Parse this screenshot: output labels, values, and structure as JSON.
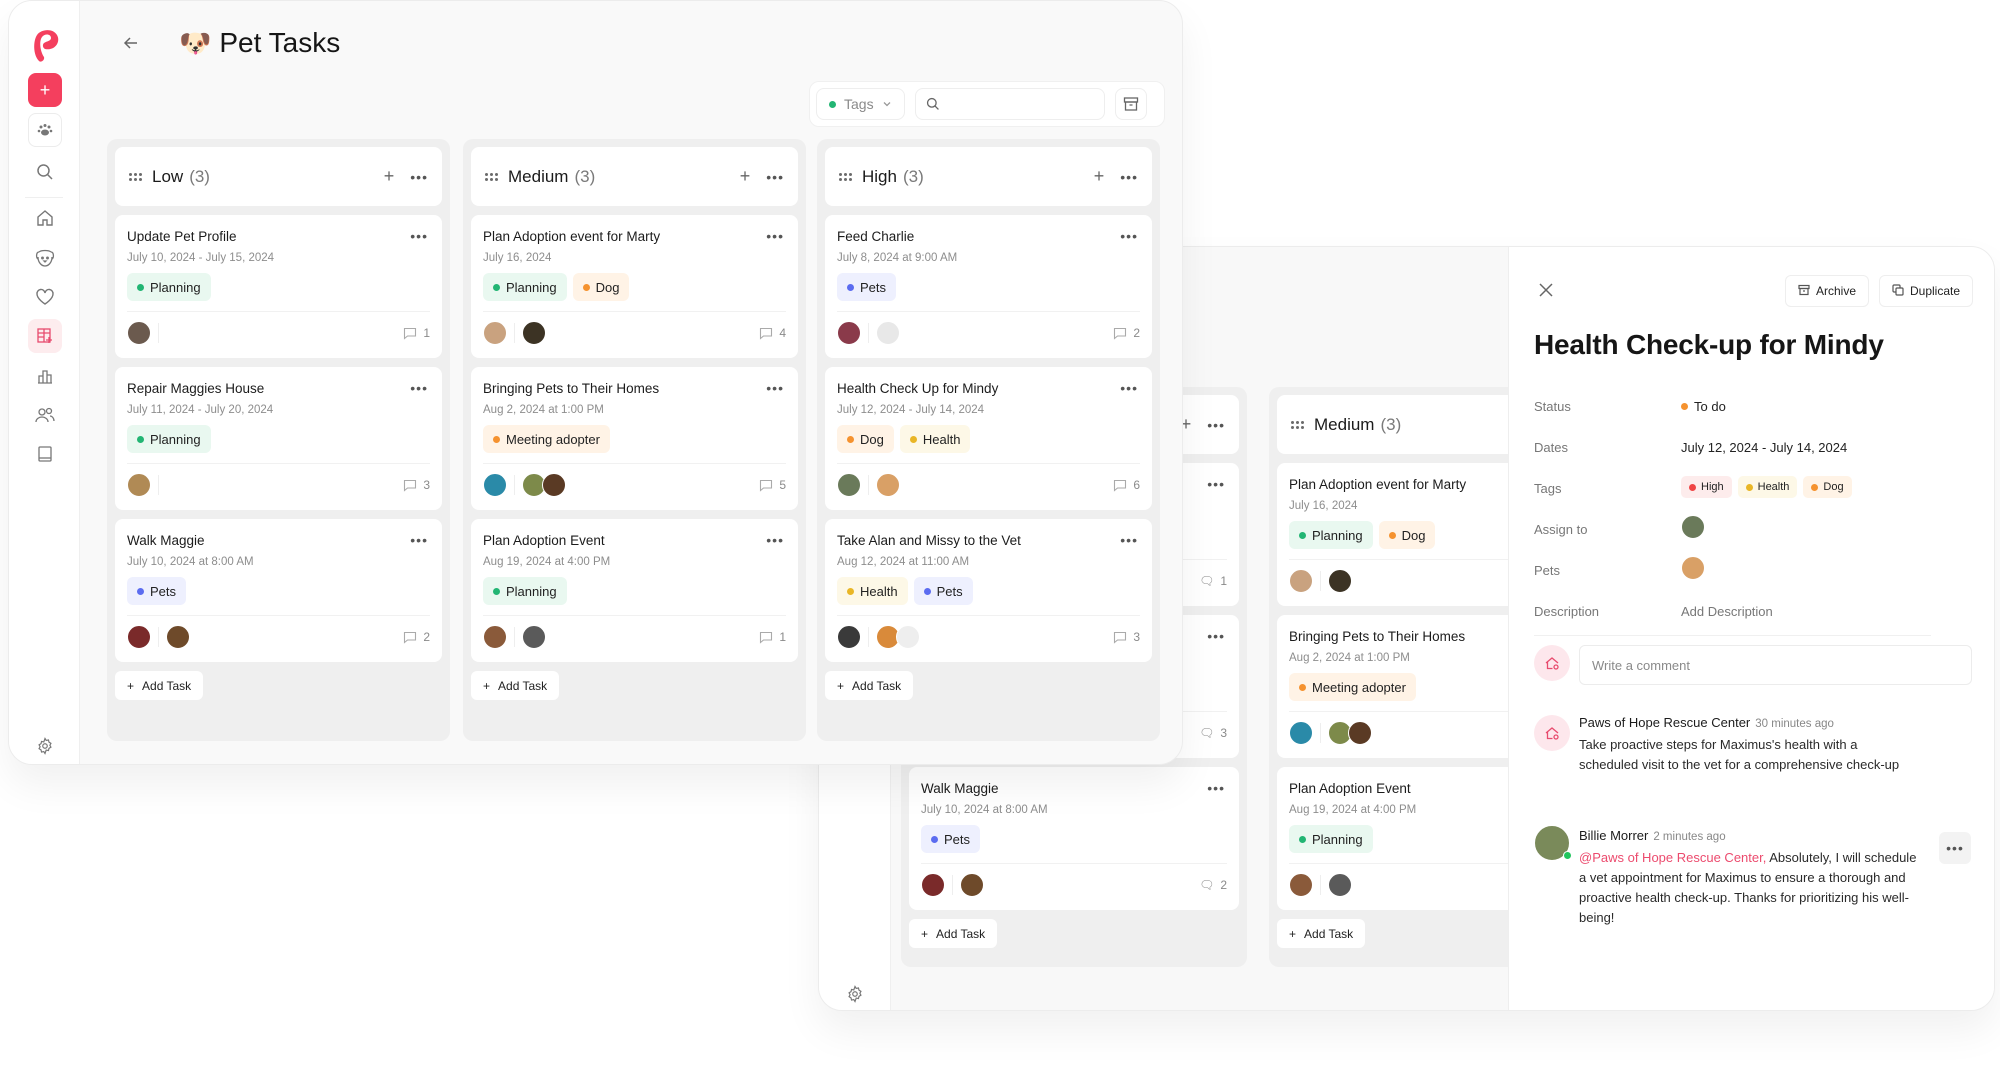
{
  "app": {
    "page_title": "Pet Tasks",
    "title_emoji": "🐶",
    "sidebar_items": [
      "add",
      "community",
      "search",
      "home",
      "pets",
      "favorites",
      "task-board",
      "reports",
      "people",
      "guides",
      "settings"
    ]
  },
  "toolbar": {
    "tags_label": "Tags",
    "search_placeholder": "",
    "archive_icon": "archive-icon"
  },
  "colors": {
    "accent": "#f43f5e",
    "planning": "#22b573",
    "dog": "#f5922f",
    "pets": "#5b6cf0",
    "health": "#e9b626",
    "high": "#ef4444",
    "meeting": "#f5922f"
  },
  "tag_styles": {
    "Planning": {
      "dot": "#22b573",
      "bg": "#e9f8f0"
    },
    "Dog": {
      "dot": "#f5922f",
      "bg": "#fff3e6"
    },
    "Pets": {
      "dot": "#5b6cf0",
      "bg": "#eef0fe"
    },
    "Health": {
      "dot": "#e9b626",
      "bg": "#fdf8e7"
    },
    "Meeting adopter": {
      "dot": "#f5922f",
      "bg": "#fff3e6"
    },
    "High": {
      "dot": "#ef4444",
      "bg": "#fdecec"
    }
  },
  "columns": [
    {
      "title": "Low",
      "count": "(3)",
      "cards": [
        {
          "title": "Update Pet Profile",
          "date": "July 10, 2024 - July 15, 2024",
          "tags": [
            "Planning"
          ],
          "assignees": [
            "#6b5a4e"
          ],
          "pets": [],
          "comments": "1"
        },
        {
          "title": "Repair Maggies House",
          "date": "July 11, 2024 - July 20, 2024",
          "tags": [
            "Planning"
          ],
          "assignees": [
            "#b08a55"
          ],
          "pets": [],
          "comments": "3"
        },
        {
          "title": "Walk Maggie",
          "date": "July 10, 2024 at 8:00 AM",
          "tags": [
            "Pets"
          ],
          "assignees": [
            "#7a2a2a"
          ],
          "pets": [
            "#6e4a2a"
          ],
          "comments": "2"
        }
      ],
      "add_label": "Add Task"
    },
    {
      "title": "Medium",
      "count": "(3)",
      "cards": [
        {
          "title": "Plan Adoption event for Marty",
          "date": "July 16, 2024",
          "tags": [
            "Planning",
            "Dog"
          ],
          "assignees": [
            "#c9a27f"
          ],
          "pets": [
            "#3c3324"
          ],
          "comments": "4"
        },
        {
          "title": "Bringing Pets to Their Homes",
          "date": "Aug 2, 2024 at 1:00 PM",
          "tags": [
            "Meeting adopter"
          ],
          "assignees": [
            "#2a8aa8"
          ],
          "pets": [
            "#7d8a4a",
            "#5a3a24"
          ],
          "comments": "5"
        },
        {
          "title": "Plan Adoption Event",
          "date": "Aug 19, 2024 at 4:00 PM",
          "tags": [
            "Planning"
          ],
          "assignees": [
            "#8a5a3a"
          ],
          "pets": [
            "#5a5a5a"
          ],
          "comments": "1"
        }
      ],
      "add_label": "Add Task"
    },
    {
      "title": "High",
      "count": "(3)",
      "cards": [
        {
          "title": "Feed Charlie",
          "date": "July 8, 2024 at 9:00 AM",
          "tags": [
            "Pets"
          ],
          "assignees": [
            "#8a3a4a"
          ],
          "pets": [
            "#e8e8e8"
          ],
          "comments": "2"
        },
        {
          "title": "Health Check Up for Mindy",
          "date": "July 12, 2024 - July 14, 2024",
          "tags": [
            "Dog",
            "Health"
          ],
          "assignees": [
            "#6a7a5a"
          ],
          "pets": [
            "#d9a066"
          ],
          "comments": "6"
        },
        {
          "title": "Take Alan and Missy to the Vet",
          "date": "Aug 12, 2024 at 11:00 AM",
          "tags": [
            "Health",
            "Pets"
          ],
          "assignees": [
            "#3a3a3a"
          ],
          "pets": [
            "#d98a3a",
            "#eeeeee"
          ],
          "comments": "3"
        }
      ],
      "add_label": "Add Task"
    }
  ],
  "detail": {
    "close_icon": "close-icon",
    "archive_label": "Archive",
    "duplicate_label": "Duplicate",
    "title": "Health Check-up for Mindy",
    "status_label": "Status",
    "status_value": "To do",
    "status_color": "#f5922f",
    "dates_label": "Dates",
    "dates_value": "July 12, 2024 - July 14, 2024",
    "tags_label": "Tags",
    "tags": [
      "High",
      "Health",
      "Dog"
    ],
    "assign_label": "Assign to",
    "pets_label": "Pets",
    "description_label": "Description",
    "description_placeholder": "Add Description",
    "comment_placeholder": "Write a comment",
    "comments": [
      {
        "author": "Paws of Hope Rescue Center",
        "time": "30 minutes ago",
        "mention": "",
        "body": "Take proactive steps for Maximus's health with a scheduled visit to the vet for a comprehensive check-up"
      },
      {
        "author": "Billie Morrer",
        "time": "2 minutes ago",
        "mention": "@Paws of Hope Rescue Center,",
        "body": " Absolutely, I will schedule a vet appointment for Maximus to ensure a thorough and proactive health check-up. Thanks for prioritizing his well-being!"
      }
    ]
  }
}
